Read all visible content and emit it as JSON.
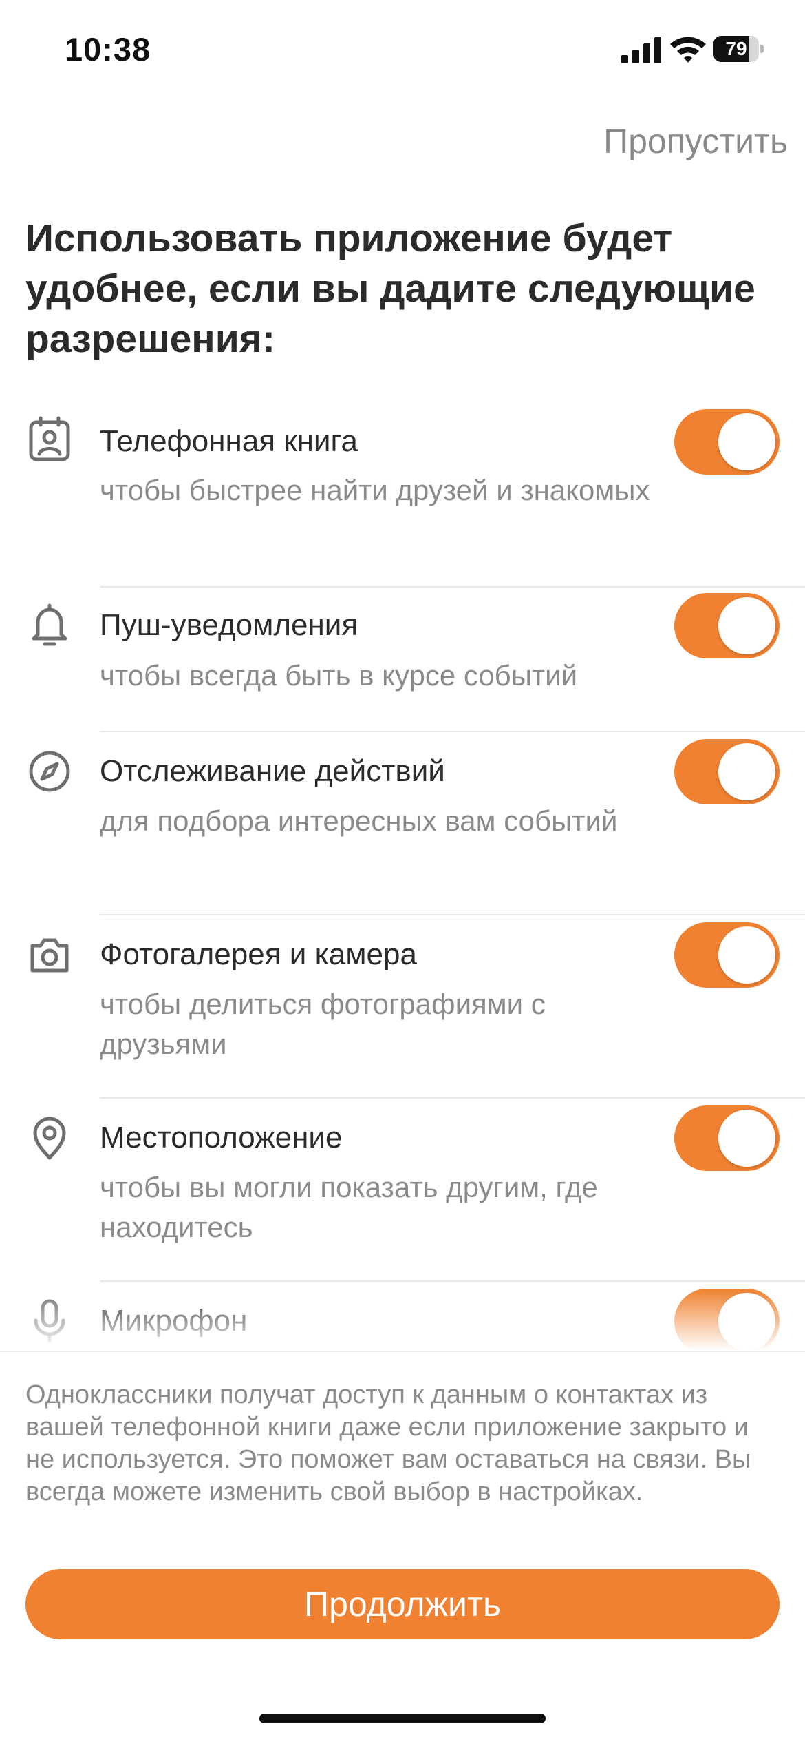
{
  "status_bar": {
    "time": "10:38",
    "battery_level": "79",
    "battery_fraction": 0.79,
    "icons": [
      "signal-icon",
      "wifi-icon",
      "battery-icon"
    ]
  },
  "header": {
    "skip_label": "Пропустить",
    "title": "Использовать приложение будет удобнее, если вы дадите следующие разрешения:"
  },
  "permissions": [
    {
      "icon": "contacts-icon",
      "title": "Телефонная книга",
      "description": "чтобы быстрее найти друзей и знакомых",
      "enabled": true
    },
    {
      "icon": "bell-icon",
      "title": "Пуш-уведомления",
      "description": "чтобы всегда быть в курсе событий",
      "enabled": true
    },
    {
      "icon": "compass-icon",
      "title": "Отслеживание действий",
      "description": "для подбора интересных вам событий",
      "enabled": true
    },
    {
      "icon": "camera-icon",
      "title": "Фотогалерея и камера",
      "description": "чтобы делиться фотографиями с друзьями",
      "enabled": true
    },
    {
      "icon": "location-pin-icon",
      "title": "Местоположение",
      "description": "чтобы вы могли показать другим, где находитесь",
      "enabled": true
    },
    {
      "icon": "microphone-icon",
      "title": "Микрофон",
      "description": "",
      "enabled": true
    }
  ],
  "footer": {
    "note": "Одноклассники получат доступ к данным о контактах из вашей телефонной книги даже если приложение закрыто и не используется. Это поможет вам оставаться на связи. Вы всегда можете изменить свой выбор в настройках.",
    "continue_label": "Продолжить"
  },
  "colors": {
    "accent": "#ef8130",
    "text_primary": "#2b2b2b",
    "text_secondary": "#8b8b8b",
    "divider": "#e8e8e8",
    "icon_gray": "#6f6f6f"
  }
}
